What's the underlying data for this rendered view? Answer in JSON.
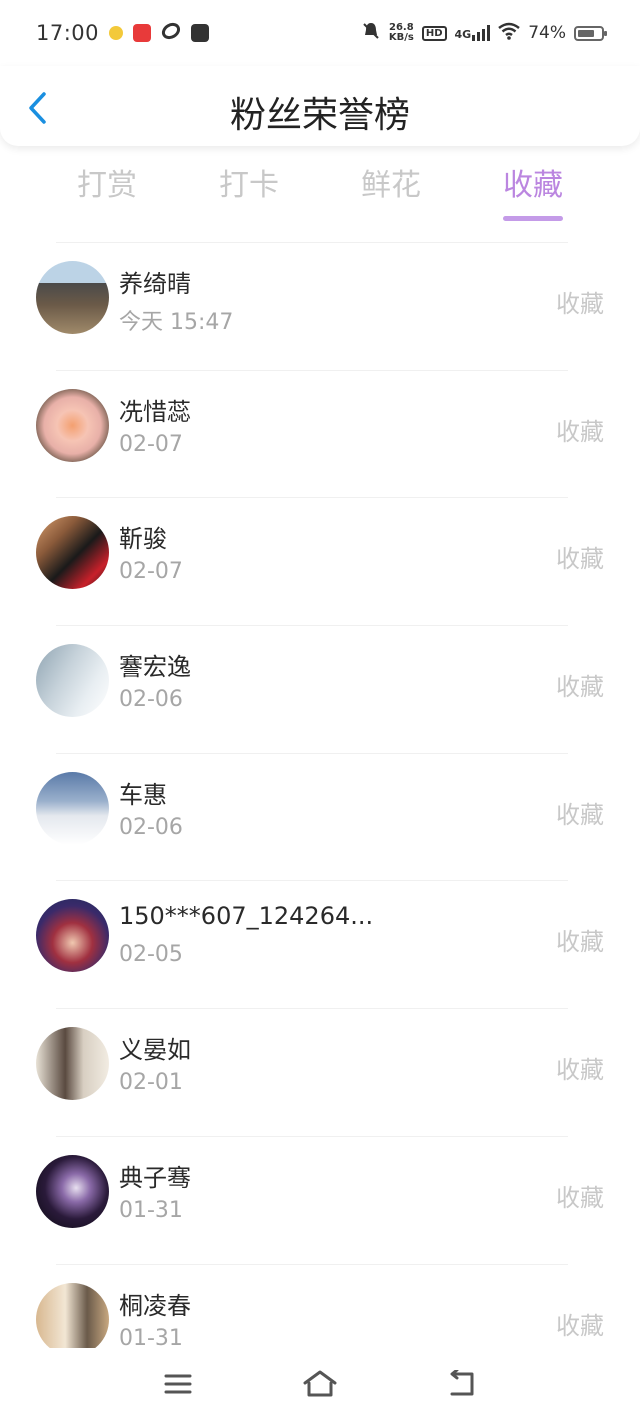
{
  "status_bar": {
    "time": "17:00",
    "net_speed_value": "26.8",
    "net_speed_unit": "KB/s",
    "hd_badge": "HD",
    "network": "4G",
    "battery_percent": "74%",
    "battery_level": 0.74,
    "icons": [
      "notification-app-icon",
      "shopping-app-icon",
      "link-app-icon",
      "mail-app-icon",
      "mute-bell-icon",
      "signal-icon",
      "wifi-icon",
      "battery-icon"
    ]
  },
  "header": {
    "title": "粉丝荣誉榜",
    "back_icon": "chevron-left-icon"
  },
  "tabs": [
    {
      "label": "打赏"
    },
    {
      "label": "打卡"
    },
    {
      "label": "鲜花"
    },
    {
      "label": "收藏"
    }
  ],
  "active_tab": 3,
  "colors": {
    "accent": "#bb86e0",
    "back_blue": "#1a8fe0",
    "muted": "#c8c8c8"
  },
  "fans": [
    {
      "name": "养绮晴",
      "date": "今天 15:47",
      "action": "收藏"
    },
    {
      "name": "冼惜蕊",
      "date": "02-07",
      "action": "收藏"
    },
    {
      "name": "靳骏",
      "date": "02-07",
      "action": "收藏"
    },
    {
      "name": "謇宏逸",
      "date": "02-06",
      "action": "收藏"
    },
    {
      "name": "车惠",
      "date": "02-06",
      "action": "收藏"
    },
    {
      "name": "150***607_124264...",
      "date": "02-05",
      "action": "收藏"
    },
    {
      "name": "义晏如",
      "date": "02-01",
      "action": "收藏"
    },
    {
      "name": "典子骞",
      "date": "01-31",
      "action": "收藏"
    },
    {
      "name": "桐凌春",
      "date": "01-31",
      "action": "收藏"
    }
  ],
  "nav": {
    "icons": [
      "menu-icon",
      "home-icon",
      "back-icon"
    ]
  }
}
